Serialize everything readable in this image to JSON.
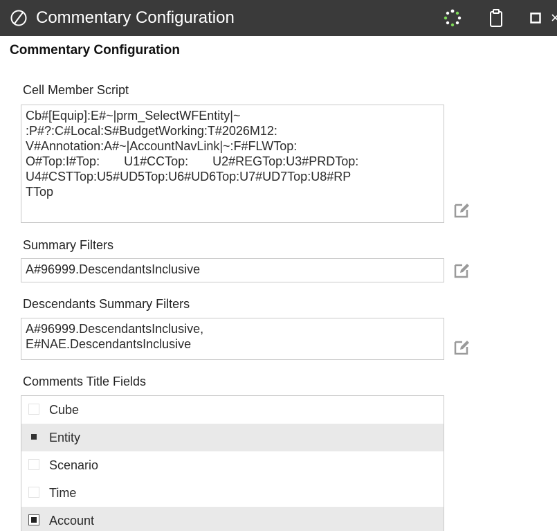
{
  "window": {
    "title": "Commentary Configuration",
    "colors": {
      "titlebar_bg": "#3a3a3a",
      "text": "#ffffff",
      "spinner": "#7ed957"
    },
    "icons": [
      "onestream-logo-icon",
      "loading-spinner-icon",
      "clipboard-icon",
      "maximize-icon",
      "close-icon"
    ]
  },
  "panel": {
    "heading": "Commentary Configuration"
  },
  "cell_member_script": {
    "label": "Cell Member Script",
    "lines": [
      "Cb#[Equip]:E#~|prm_SelectWFEntity|~",
      ":P#?:C#Local:S#BudgetWorking:T#2026M12:",
      "V#Annotation:A#~|AccountNavLink|~:F#FLWTop:",
      "O#Top:I#Top:       U1#CCTop:       U2#REGTop:U3#PRDTop:",
      "U4#CSTTop:U5#UD5Top:U6#UD6Top:U7#UD7Top:U8#RP",
      "TTop"
    ]
  },
  "summary_filters": {
    "label": "Summary Filters",
    "value": "A#96999.DescendantsInclusive"
  },
  "descendants_summary_filters": {
    "label": "Descendants Summary Filters",
    "lines": [
      "A#96999.DescendantsInclusive,",
      "E#NAE.DescendantsInclusive"
    ]
  },
  "comments_title_fields": {
    "label": "Comments Title Fields",
    "items": [
      {
        "label": "Cube",
        "checked": false,
        "selected": false
      },
      {
        "label": "Entity",
        "checked": true,
        "selected": true
      },
      {
        "label": "Scenario",
        "checked": false,
        "selected": false
      },
      {
        "label": "Time",
        "checked": false,
        "selected": false
      },
      {
        "label": "Account",
        "checked": true,
        "selected": true
      }
    ]
  }
}
